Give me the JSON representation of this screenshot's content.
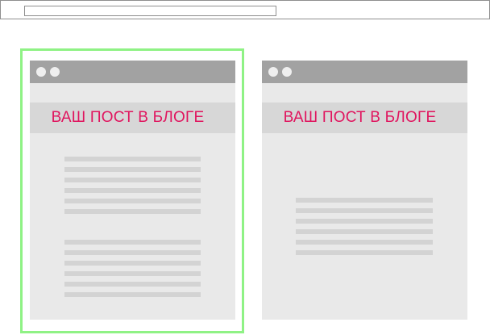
{
  "header": {
    "address_bar": ""
  },
  "colors": {
    "accent_title": "#e0145e",
    "selection_border": "#8ff285",
    "chrome_bar": "#a2a2a2",
    "page_bg": "#e9e9e9"
  },
  "mockups": [
    {
      "title": "ВАШ ПОСТ В БЛОГЕ",
      "selected": true,
      "line_groups": [
        6,
        6
      ]
    },
    {
      "title": "ВАШ ПОСТ В БЛОГЕ",
      "selected": false,
      "line_groups": [
        6
      ]
    }
  ]
}
